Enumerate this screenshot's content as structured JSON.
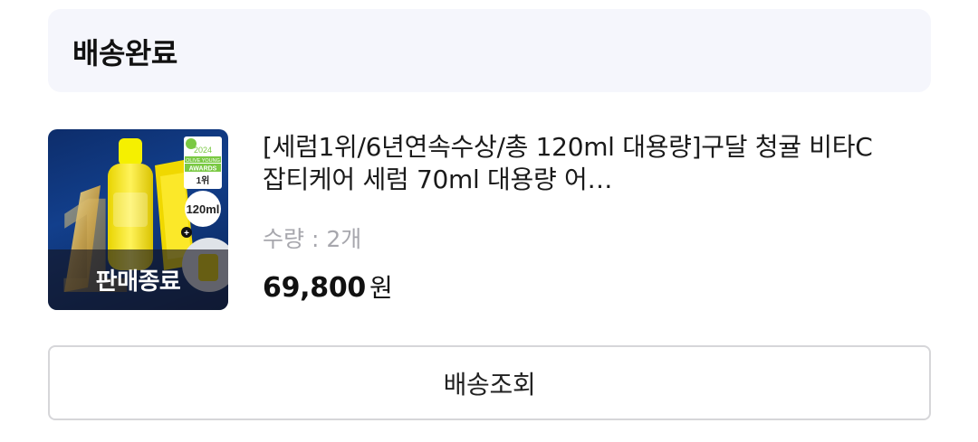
{
  "order_status": {
    "title": "배송완료"
  },
  "item": {
    "name": "[세럼1위/6년연속수상/총 120ml 대용량]구달 청귤 비타C 잡티케어 세럼 70ml 대용량 어…",
    "quantity_text": "수량 : 2개",
    "price": "69,800",
    "price_unit": "원",
    "soldout_label": "판매종료",
    "thumb": {
      "rank_numeral": "1",
      "award_year": "2024",
      "award_text_1": "OLIVE YOUNG",
      "award_text_2": "AWARDS",
      "award_rank": "1위",
      "volume_badge": "120ml"
    }
  },
  "actions": {
    "track_label": "배송조회"
  },
  "colors": {
    "header_bg": "#f5f6fc",
    "quantity_text": "#a7a7ad",
    "button_border": "#d6d6d9",
    "thumb_bg": "#123f8c"
  }
}
